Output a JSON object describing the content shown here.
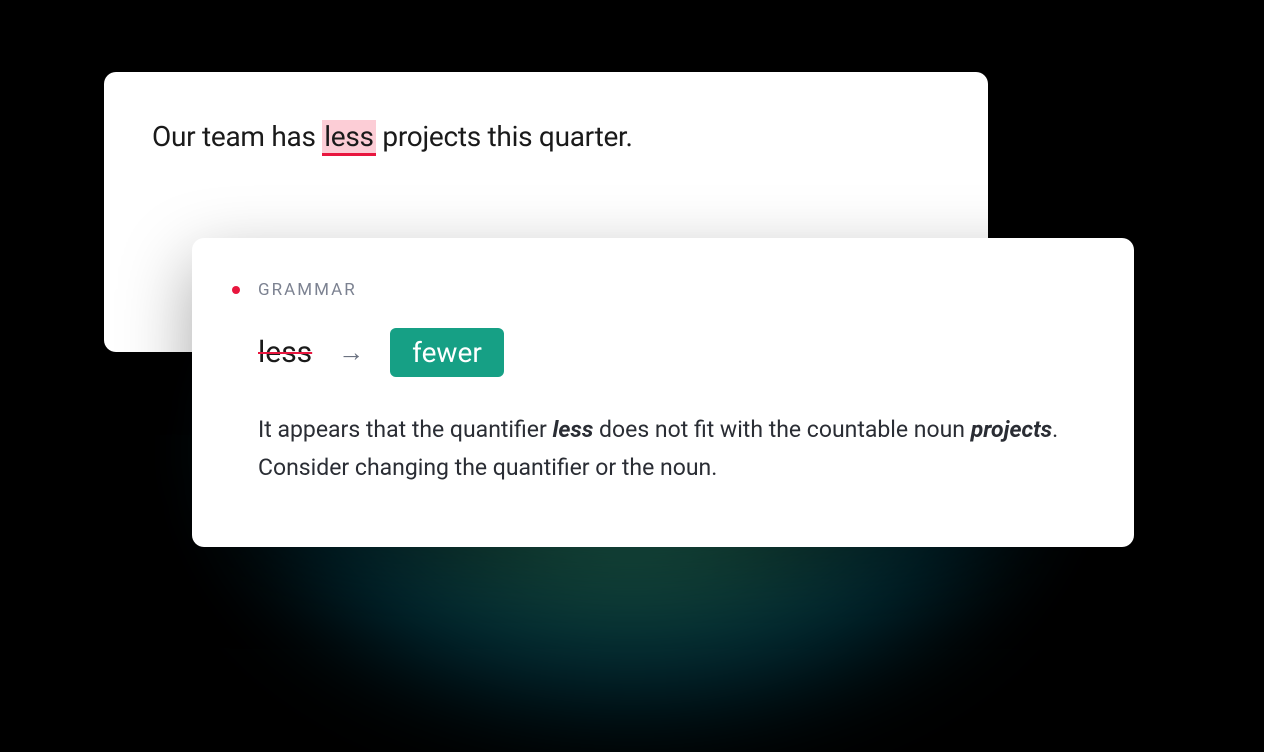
{
  "editor": {
    "text_before": "Our team has ",
    "highlighted_word": "less",
    "text_after": " projects this quarter."
  },
  "suggestion": {
    "category": "GRAMMAR",
    "original_word": "less",
    "replacement_word": "fewer",
    "description_parts": {
      "p1": "It appears that the quantifier ",
      "em1": "less",
      "p2": " does not fit with the countable noun ",
      "em2": "projects",
      "p3": ". Consider changing the quantifier or the noun."
    }
  }
}
